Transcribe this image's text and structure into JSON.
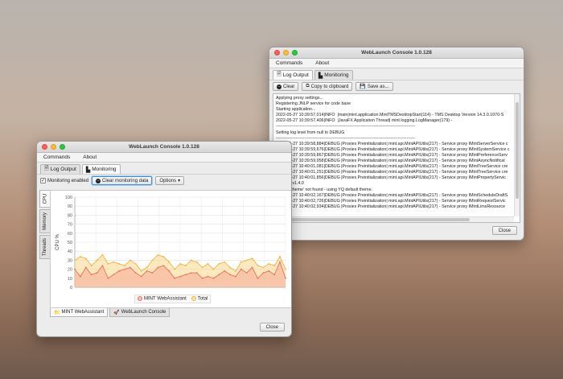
{
  "console": {
    "title": "WebLaunch Console 1.0.128",
    "menu": [
      "Commands",
      "About"
    ],
    "tabs": [
      {
        "label": "Log Output",
        "icon": "document-icon"
      },
      {
        "label": "Monitoring",
        "icon": "bar-chart-icon"
      }
    ],
    "toolbar": {
      "clear": "Clear",
      "copy": "Copy to clipboard",
      "save": "Save as..."
    },
    "log": [
      "Applying proxy settings...",
      "Registering JNLP service for code base",
      "Starting application...",
      "2022-05-27 10:39:57,014|INFO  |main|mint.application.MintTMSDesktopStart(114) - TMS Desktop Version 14.3.0.1070-S",
      "2022-05-27 10:39:57,406|INFO  |JavaFX Application Thread| mint.logging.LogManager(179) -",
      "--------------------------------------------------------------------------------------------------",
      "Setting log level from null to DEBUG",
      "--------------------------------------------------------------------------------------------------",
      "2022-05-27 10:39:58,884|DEBUG |Proxies Preinitialization| mint.api.MintAPIUtils(217) - Service proxy IMintServerService c",
      "2022-05-27 10:39:59,676|DEBUG |Proxies Preinitialization| mint.api.MintAPIUtils(217) - Service proxy IMintSystemService c",
      "2022-05-27 10:39:59,867|DEBUG |Proxies Preinitialization| mint.api.MintAPIUtils(217) - Service proxy IMintPreferenceServ",
      "2022-05-27 10:39:59,958|DEBUG |Proxies Preinitialization| mint.api.MintAPIUtils(217) - Service proxy IMintAsyncNotificat",
      "2022-05-27 10:40:01,081|DEBUG |Proxies Preinitialization| mint.api.MintAPIUtils(217) - Service proxy IMintTreeService cre",
      "2022-05-27 10:40:01,251|DEBUG |Proxies Preinitialization| mint.api.MintAPIUtils(217) - Service proxy IMintTreeService cre",
      "2022-05-27 10:40:01,856|DEBUG |Proxies Preinitialization| mint.api.MintAPIUtils(217) - Service proxy IMintPropertyServic",
      "TinyLaF v1.4.0",
      "'Default.theme' not found - using YQ default theme.",
      "2022-05-27 10:40:02,167|DEBUG |Proxies Preinitialization| mint.api.MintAPIUtils(217) - Service proxy IMintScheduleDraftS",
      "2022-05-27 10:40:02,726|DEBUG |Proxies Preinitialization| mint.api.MintAPIUtils(217) - Service proxy IMintRequestServic",
      "2022-05-27 10:40:02,934|DEBUG |Proxies Preinitialization| mint.api.MintAPIUtils(217) - Service proxy IMintLimsResource"
    ],
    "close": "Close"
  },
  "monitor": {
    "title": "WebLaunch Console 1.0.128",
    "menu": [
      "Commands",
      "About"
    ],
    "tabs": [
      {
        "label": "Log Output",
        "icon": "document-icon"
      },
      {
        "label": "Monitoring",
        "icon": "bar-chart-icon"
      }
    ],
    "monitoring_enabled": "Monitoring enabled",
    "clear_monitoring": "Clear monitoring data",
    "options": "Options",
    "side_tabs": [
      "CPU",
      "Memory",
      "Threads"
    ],
    "bottom_tabs": [
      "MINT WebAssistant",
      "WebLaunch Console"
    ],
    "close": "Close",
    "colors": {
      "mint": "#e8705a",
      "total": "#f0b43c"
    }
  },
  "chart_data": {
    "type": "area",
    "ylabel": "CPU %",
    "ylim": [
      0,
      100
    ],
    "yticks": [
      0,
      10,
      20,
      30,
      40,
      50,
      60,
      70,
      80,
      90,
      100
    ],
    "series": [
      {
        "name": "MINT WebAssistant",
        "values": [
          20,
          12,
          22,
          14,
          16,
          24,
          10,
          14,
          18,
          20,
          22,
          16,
          12,
          18,
          16,
          22,
          24,
          18,
          10,
          12,
          14,
          16,
          16,
          10,
          12,
          10,
          14,
          18,
          14,
          12,
          20,
          16,
          22,
          10,
          16,
          18,
          14,
          28,
          10
        ]
      },
      {
        "name": "Total",
        "values": [
          30,
          34,
          32,
          24,
          30,
          36,
          26,
          28,
          26,
          24,
          30,
          26,
          18,
          22,
          30,
          36,
          34,
          28,
          20,
          26,
          24,
          30,
          28,
          22,
          26,
          20,
          26,
          28,
          22,
          18,
          28,
          30,
          32,
          24,
          22,
          26,
          24,
          34,
          20
        ]
      }
    ]
  }
}
